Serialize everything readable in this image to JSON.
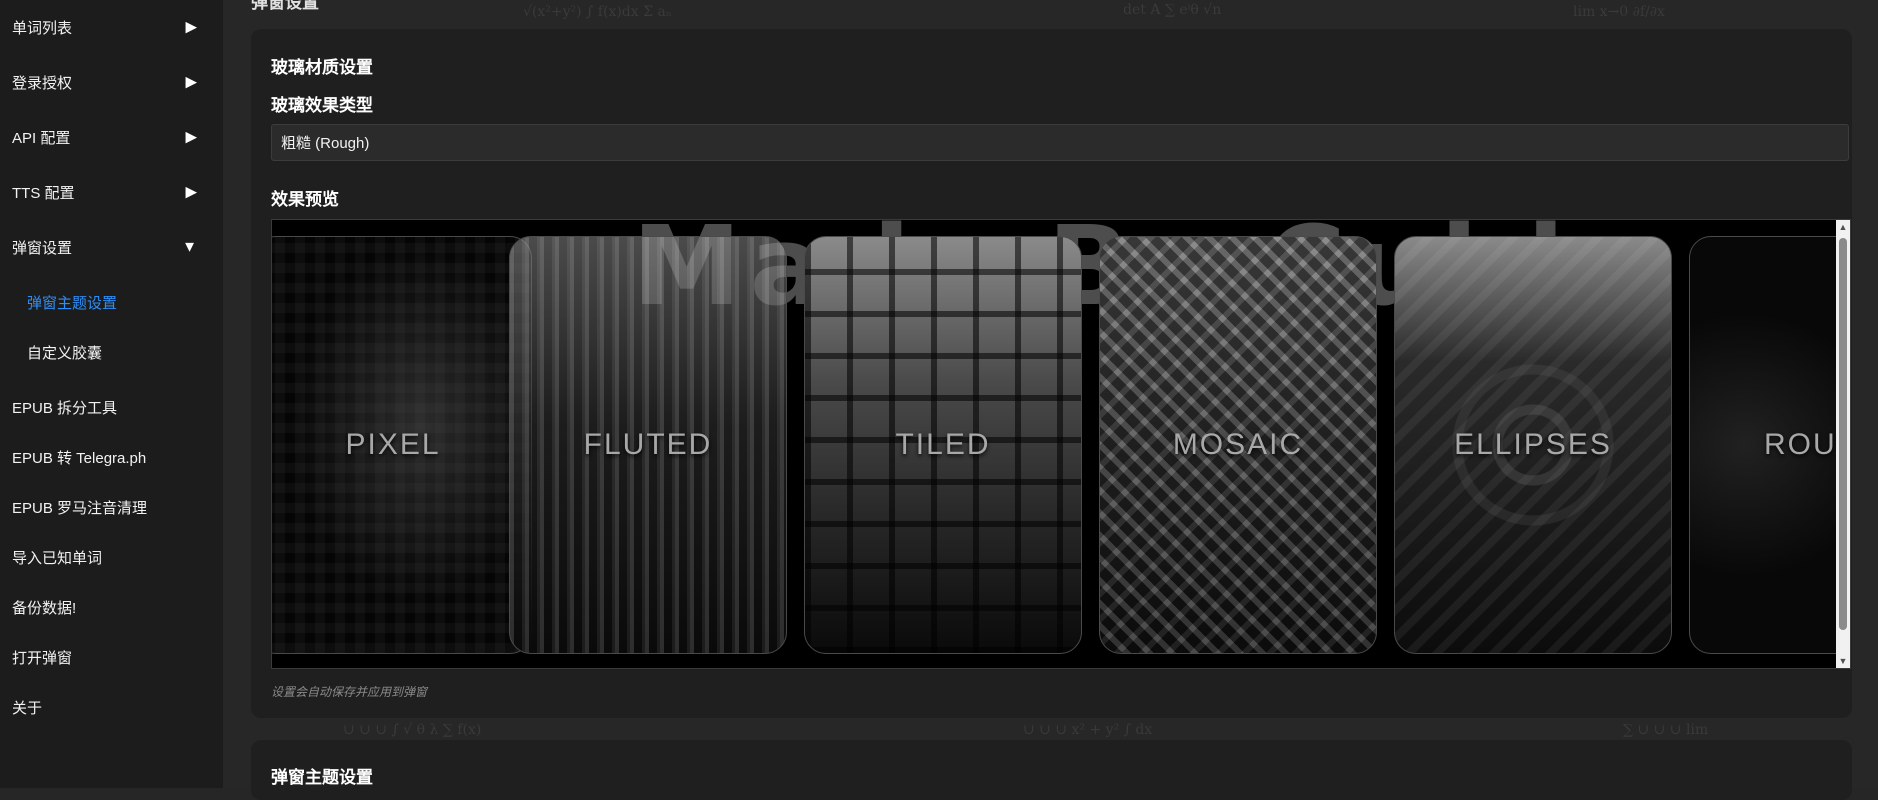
{
  "sidebar": {
    "items": [
      {
        "label": "单词列表",
        "arrow": "▶"
      },
      {
        "label": "登录授权",
        "arrow": "▶"
      },
      {
        "label": "API 配置",
        "arrow": "▶"
      },
      {
        "label": "TTS 配置",
        "arrow": "▶"
      },
      {
        "label": "弹窗设置",
        "arrow": "▼"
      },
      {
        "label": "弹窗主题设置"
      },
      {
        "label": "自定义胶囊"
      },
      {
        "label": "EPUB 拆分工具"
      },
      {
        "label": "EPUB 转 Telegra.ph"
      },
      {
        "label": "EPUB 罗马注音清理"
      },
      {
        "label": "导入已知单词"
      },
      {
        "label": "备份数据!"
      },
      {
        "label": "打开弹窗"
      },
      {
        "label": "关于"
      }
    ],
    "active_color": "#2f8ef5"
  },
  "main": {
    "cut_title": "弹窗设置",
    "glass_card": {
      "title": "玻璃材质设置",
      "type_label": "玻璃效果类型",
      "type_value": "粗糙 (Rough)",
      "preview_label": "效果预览",
      "preview_bg_text": "Made By Cubic",
      "effects": [
        "PIXEL",
        "FLUTED",
        "TILED",
        "MOSAIC",
        "ELLIPSES",
        "ROU"
      ],
      "hint": "设置会自动保存并应用到弹窗"
    },
    "theme_card": {
      "title": "弹窗主题设置"
    }
  },
  "icons": {
    "collapsed": "arrow-right-icon",
    "expanded": "arrow-down-icon"
  }
}
